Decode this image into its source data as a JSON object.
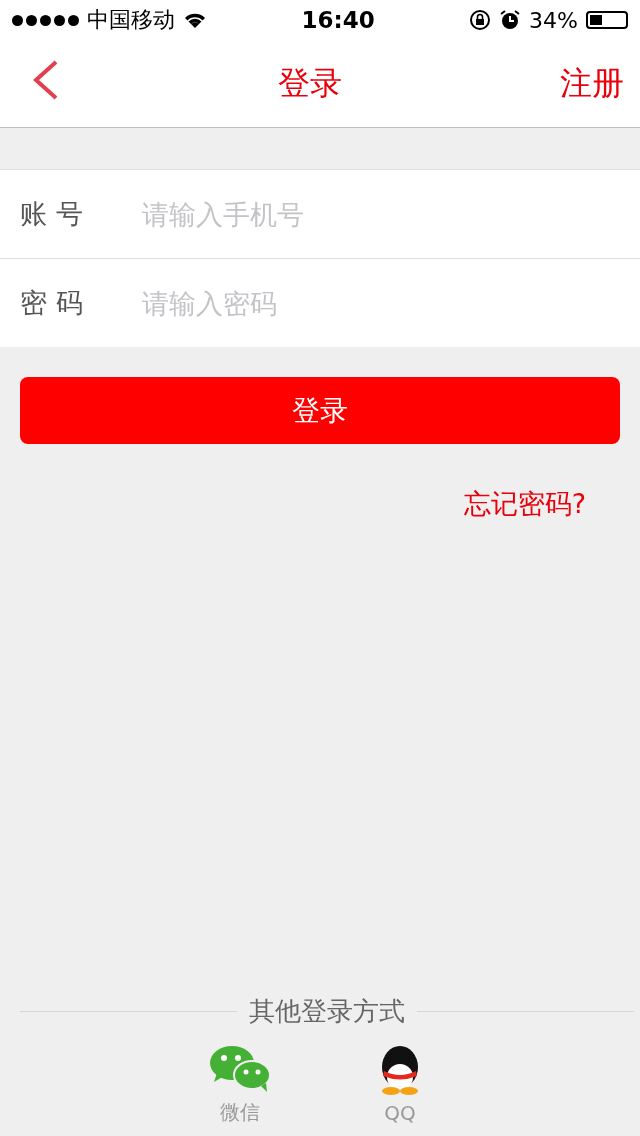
{
  "status_bar": {
    "carrier": "中国移动",
    "time": "16:40",
    "battery": "34%"
  },
  "nav_bar": {
    "title": "登录",
    "action": "注册"
  },
  "fields": [
    {
      "label": "账 号",
      "placeholder": "请输入手机号"
    },
    {
      "label": "密 码",
      "placeholder": "请输入密码"
    }
  ],
  "login_button": "登录",
  "forgot_link": "忘记密码?",
  "other_login": {
    "title": "其他登录方式",
    "options": [
      {
        "kind": "wechat",
        "label": "微信"
      },
      {
        "kind": "qq",
        "label": "QQ"
      }
    ]
  }
}
